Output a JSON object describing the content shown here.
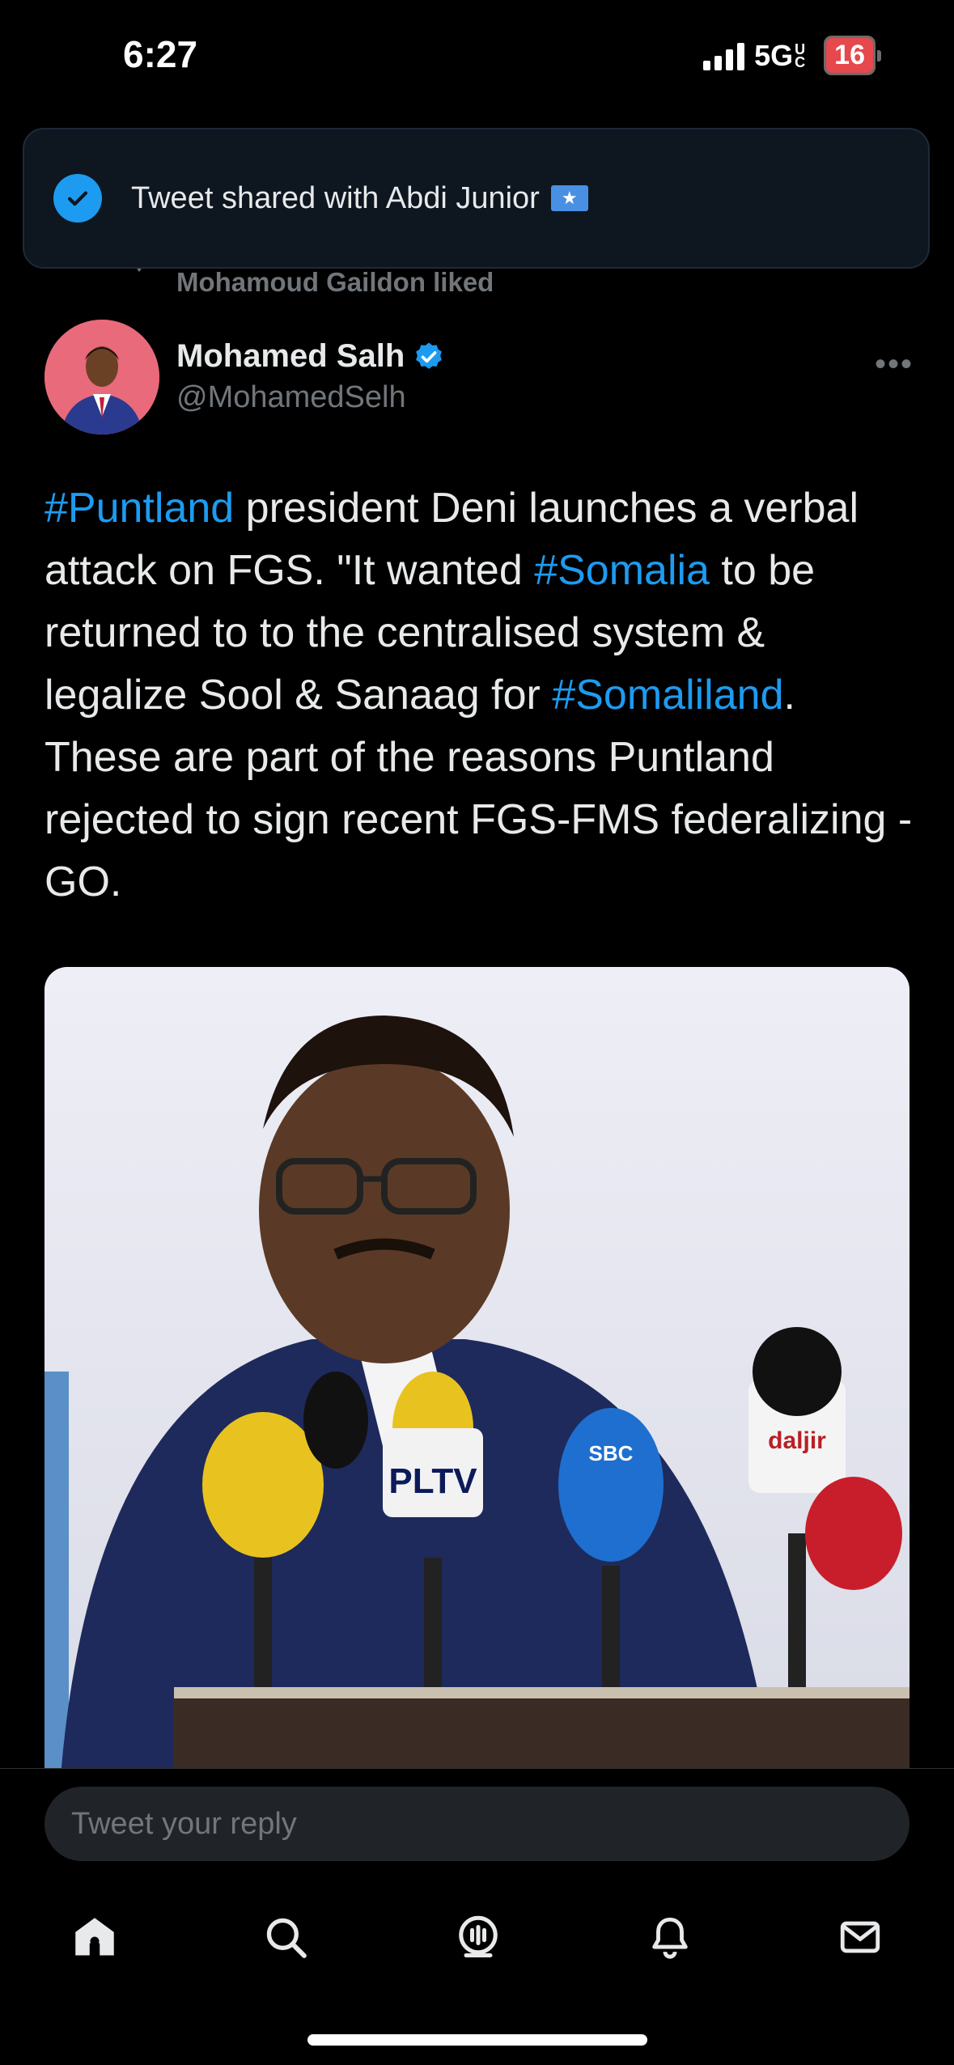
{
  "status_bar": {
    "time": "6:27",
    "network": "5G",
    "network_suffix": "UC",
    "battery": "16"
  },
  "toast": {
    "text": "Tweet shared with Abdi Junior",
    "icon": "check-circle-icon"
  },
  "social_context": {
    "text": "Mohamoud Gaildon liked",
    "icon": "heart-icon"
  },
  "author": {
    "name": "Mohamed Salh",
    "handle": "@MohamedSelh",
    "verified": true
  },
  "tweet": {
    "segments": [
      {
        "text": "#Puntland",
        "hashtag": true
      },
      {
        "text": " president Deni launches a verbal attack on FGS. \"It wanted ",
        "hashtag": false
      },
      {
        "text": "#Somalia",
        "hashtag": true
      },
      {
        "text": " to be returned to to the centralised system & legalize Sool & Sanaag for ",
        "hashtag": false
      },
      {
        "text": "#Somaliland",
        "hashtag": true
      },
      {
        "text": ". These are part of the reasons Puntland rejected to sign recent FGS-FMS federalizing - GO.",
        "hashtag": false
      }
    ]
  },
  "media": {
    "mic_labels": {
      "m1": "PLTV",
      "m2": "SBC",
      "m3": "daljir"
    }
  },
  "reply": {
    "placeholder": "Tweet your reply"
  },
  "tabs": [
    "home-icon",
    "search-icon",
    "spaces-icon",
    "notifications-icon",
    "messages-icon"
  ],
  "colors": {
    "accent": "#1d9bf0",
    "background": "#000000",
    "secondary_text": "#71767b"
  }
}
